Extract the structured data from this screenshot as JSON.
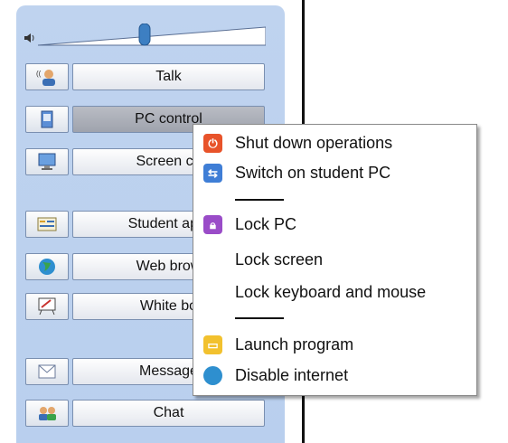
{
  "sidebar": {
    "volume": {
      "icon": "speaker-icon",
      "level": 0.5
    },
    "buttons": [
      {
        "icon": "talk-icon",
        "label": "Talk",
        "active": false
      },
      {
        "icon": "pc-control-icon",
        "label": "PC control",
        "active": true
      },
      {
        "icon": "screen-control-icon",
        "label": "Screen co",
        "active": false
      },
      {
        "icon": "student-apps-icon",
        "label": "Student appl",
        "active": false
      },
      {
        "icon": "web-browser-icon",
        "label": "Web brow",
        "active": false
      },
      {
        "icon": "whiteboard-icon",
        "label": "White bo",
        "active": false
      },
      {
        "icon": "message-icon",
        "label": "Message",
        "active": false
      },
      {
        "icon": "chat-icon",
        "label": "Chat",
        "active": false
      }
    ]
  },
  "menu": {
    "items": [
      {
        "icon": "power-icon",
        "label": "Shut down operations",
        "color": "#e8532a"
      },
      {
        "icon": "switch-on-icon",
        "label": "Switch on student PC",
        "color": "#3f7ed6"
      },
      {
        "icon": "lock-icon",
        "label": "Lock PC",
        "color": "#9a4cc8"
      },
      {
        "icon": "",
        "label": "Lock screen"
      },
      {
        "icon": "",
        "label": "Lock keyboard and mouse"
      },
      {
        "icon": "launch-icon",
        "label": "Launch program",
        "color": "#f2c12e"
      },
      {
        "icon": "globe-icon",
        "label": "Disable internet",
        "color": "#2e8fcf"
      }
    ]
  }
}
